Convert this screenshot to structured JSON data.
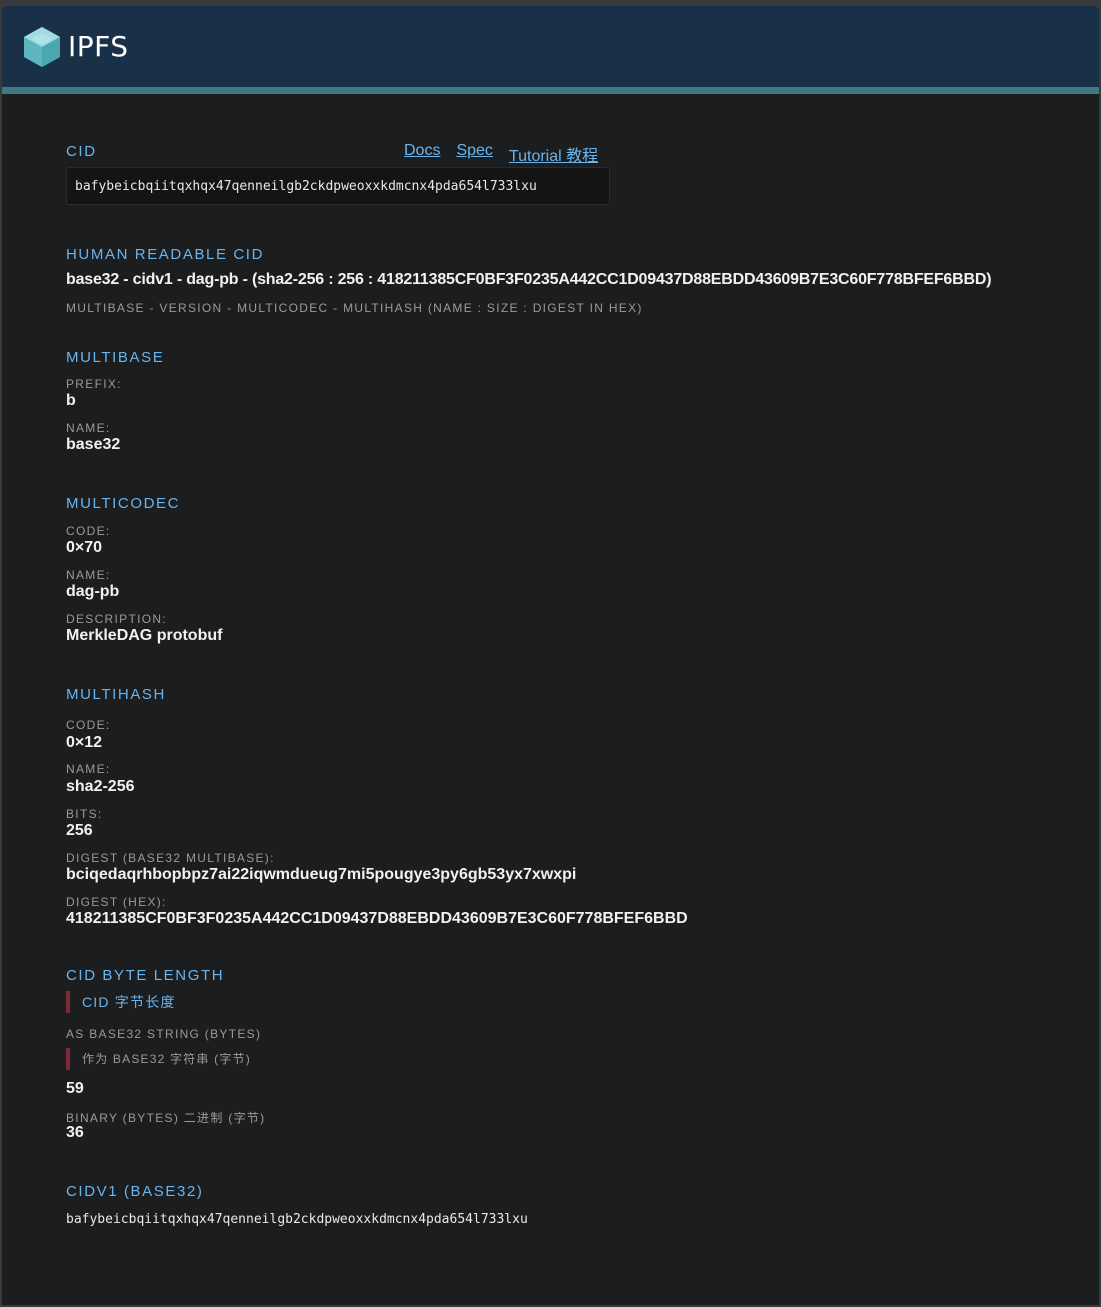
{
  "app": {
    "logo_text": "IPFS"
  },
  "cid_section": {
    "title": "CID",
    "value": "bafybeicbqiitqxhqx47qenneilgb2ckdpweoxxkdmcnx4pda654l733lxu",
    "links": {
      "docs": "Docs",
      "spec": "Spec",
      "tutorial": "Tutorial 教程"
    }
  },
  "human_readable": {
    "title": "HUMAN READABLE CID",
    "value": "base32 - cidv1 - dag-pb - (sha2-256 : 256 : 418211385CF0BF3F0235A442CC1D09437D88EBDD43609B7E3C60F778BFEF6BBD)",
    "legend": "MULTIBASE - VERSION - MULTICODEC - MULTIHASH (NAME : SIZE : DIGEST IN HEX)"
  },
  "multibase": {
    "title": "MULTIBASE",
    "prefix_label": "PREFIX:",
    "prefix": "b",
    "name_label": "NAME:",
    "name": "base32"
  },
  "multicodec": {
    "title": "MULTICODEC",
    "code_label": "CODE:",
    "code": "0×70",
    "name_label": "NAME:",
    "name": "dag-pb",
    "description_label": "DESCRIPTION:",
    "description": "MerkleDAG protobuf"
  },
  "multihash": {
    "title": "MULTIHASH",
    "code_label": "CODE:",
    "code": "0×12",
    "name_label": "NAME:",
    "name": "sha2-256",
    "bits_label": "BITS:",
    "bits": "256",
    "digest_b32_label": "DIGEST (BASE32 MULTIBASE):",
    "digest_b32": "bciqedaqrhbopbpz7ai22iqwmdueug7mi5pougye3py6gb53yx7xwxpi",
    "digest_hex_label": "DIGEST (HEX):",
    "digest_hex": "418211385CF0BF3F0235A442CC1D09437D88EBDD43609B7E3C60F778BFEF6BBD"
  },
  "byte_length": {
    "title": "CID BYTE LENGTH",
    "title_zh": "CID 字节长度",
    "base32_label": "AS BASE32 STRING (BYTES)",
    "base32_label_zh": "作为 BASE32 字符串 (字节)",
    "base32_value": "59",
    "binary_label": "BINARY (BYTES)  二进制 (字节)",
    "binary_value": "36"
  },
  "cidv1": {
    "title": "CIDV1 (BASE32)",
    "value": "bafybeicbqiitqxhqx47qenneilgb2ckdpweoxxkdmcnx4pda654l733lxu"
  },
  "colors": {
    "header_bg": "#193148",
    "header_border": "#3f7a84",
    "accent": "#6ab4ee",
    "quote_bar": "#7d2a36",
    "page_bg": "#1c1d1f"
  }
}
